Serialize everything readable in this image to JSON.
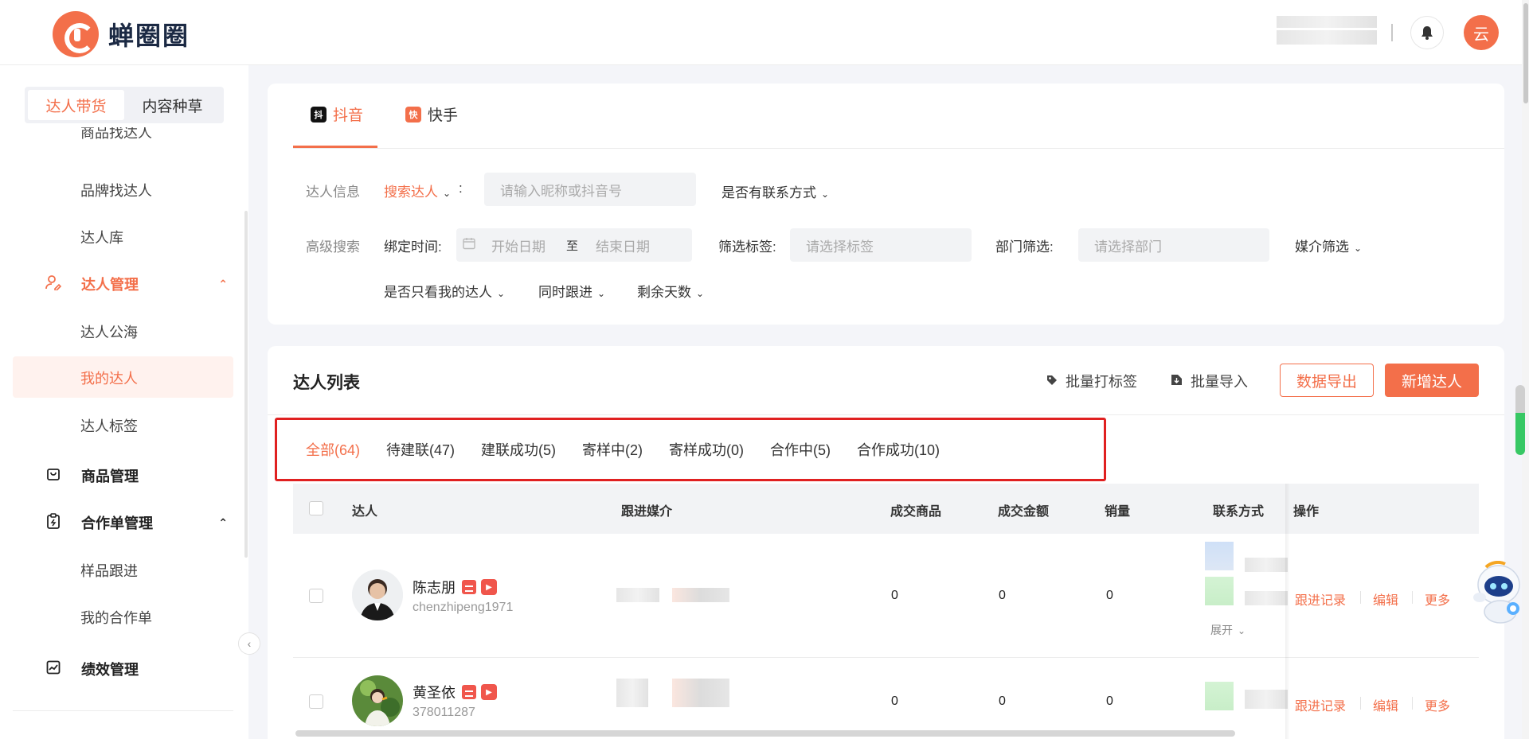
{
  "header": {
    "logo_text": "蝉圈圈",
    "avatar_text": "云",
    "bell_icon": "bell-icon"
  },
  "sidebar": {
    "segments": [
      "达人带货",
      "内容种草"
    ],
    "items": {
      "product_find": "商品找达人",
      "brand_find": "品牌找达人",
      "library": "达人库",
      "talent_mgmt": "达人管理",
      "public_pool": "达人公海",
      "my_talents": "我的达人",
      "talent_tags": "达人标签",
      "product_mgmt": "商品管理",
      "coop_mgmt": "合作单管理",
      "sample_follow": "样品跟进",
      "my_coop": "我的合作单",
      "perf_mgmt": "绩效管理"
    }
  },
  "platform_tabs": [
    "抖音",
    "快手"
  ],
  "filters": {
    "info_label": "达人信息",
    "search_type": "搜索达人",
    "colon": ":",
    "search_placeholder": "请输入昵称或抖音号",
    "has_contact": "是否有联系方式",
    "advanced_label": "高级搜索",
    "bind_time_label": "绑定时间:",
    "start_date": "开始日期",
    "date_sep": "至",
    "end_date": "结束日期",
    "tag_label": "筛选标签:",
    "tag_placeholder": "请选择标签",
    "dept_label": "部门筛选:",
    "dept_placeholder": "请选择部门",
    "media_filter": "媒介筛选",
    "only_mine": "是否只看我的达人",
    "follow_together": "同时跟进",
    "days_left": "剩余天数"
  },
  "list": {
    "title": "达人列表",
    "batch_tag": "批量打标签",
    "batch_import": "批量导入",
    "export": "数据导出",
    "add": "新增达人",
    "status_tabs": [
      "全部(64)",
      "待建联(47)",
      "建联成功(5)",
      "寄样中(2)",
      "寄样成功(0)",
      "合作中(5)",
      "合作成功(10)"
    ],
    "columns": [
      "达人",
      "跟进媒介",
      "成交商品",
      "成交金额",
      "销量",
      "联系方式",
      "操作"
    ],
    "rows": [
      {
        "name": "陈志朋",
        "id": "chenzhipeng1971",
        "products": "0",
        "amount": "0",
        "sales": "0",
        "expand": "展开"
      },
      {
        "name": "黄圣依",
        "id": "378011287",
        "products": "0",
        "amount": "0",
        "sales": "0",
        "expand": ""
      }
    ],
    "ops": [
      "跟进记录",
      "编辑",
      "更多"
    ]
  },
  "colors": {
    "accent": "#f36f4a",
    "highlight_frame": "#e02020"
  }
}
